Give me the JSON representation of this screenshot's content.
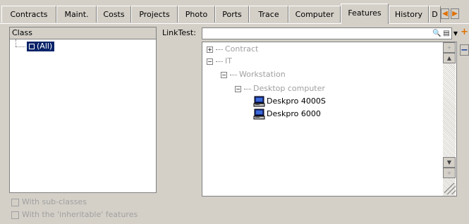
{
  "tabs": [
    {
      "label": "Contracts",
      "active": false
    },
    {
      "label": "Maint.",
      "active": false
    },
    {
      "label": "Costs",
      "active": false
    },
    {
      "label": "Projects",
      "active": false
    },
    {
      "label": "Photo",
      "active": false
    },
    {
      "label": "Ports",
      "active": false
    },
    {
      "label": "Trace",
      "active": false
    },
    {
      "label": "Computer",
      "active": false
    },
    {
      "label": "Features",
      "active": true
    },
    {
      "label": "History",
      "active": false
    },
    {
      "label": "D",
      "active": false
    }
  ],
  "class_panel": {
    "header": "Class",
    "selected_item": "(All)"
  },
  "linktest": {
    "label": "LinkTest:",
    "value": ""
  },
  "tree": [
    {
      "expander": "+",
      "label": "Contract",
      "disabled": true
    },
    {
      "expander": "−",
      "label": "IT",
      "disabled": true
    },
    {
      "expander": "−",
      "label": "Workstation",
      "disabled": true
    },
    {
      "expander": "−",
      "label": "Desktop computer",
      "disabled": true
    },
    {
      "expander": "",
      "label": "Deskpro 4000S",
      "disabled": false,
      "icon": "computer-icon"
    },
    {
      "expander": "",
      "label": "Deskpro 6000",
      "disabled": false,
      "icon": "computer-icon"
    }
  ],
  "options": {
    "with_subclasses": "With sub-classes",
    "with_inheritable": "With the 'inheritable' features"
  },
  "colors": {
    "selection": "#0a246a",
    "add_accent": "#e07000",
    "remove_accent": "#1b3fa0",
    "disabled_text": "#a0a0a0"
  }
}
